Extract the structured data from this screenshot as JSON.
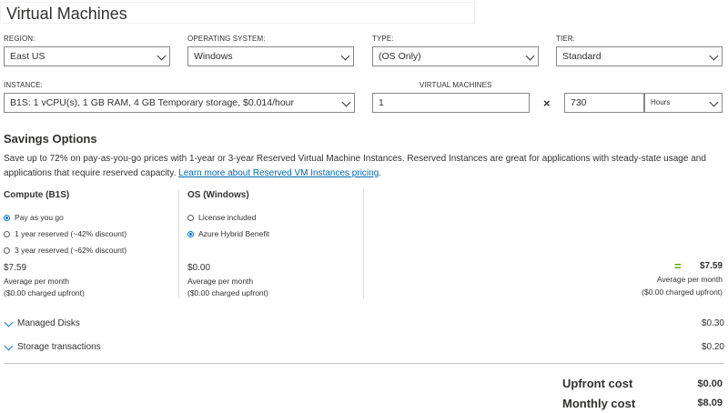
{
  "header": {
    "title": "Virtual Machines"
  },
  "fields": {
    "region": {
      "label": "REGION:",
      "value": "East US"
    },
    "os": {
      "label": "OPERATING SYSTEM:",
      "value": "Windows"
    },
    "type": {
      "label": "TYPE:",
      "value": "(OS Only)"
    },
    "tier": {
      "label": "TIER:",
      "value": "Standard"
    },
    "instance": {
      "label": "INSTANCE:",
      "value": "B1S: 1 vCPU(s), 1 GB RAM, 4 GB Temporary storage, $0.014/hour"
    },
    "vm_count": {
      "label": "VIRTUAL MACHINES",
      "value": "1"
    },
    "multiply": "×",
    "hours": {
      "value": "730",
      "unit": "Hours"
    }
  },
  "savings": {
    "title": "Savings Options",
    "description": "Save up to 72% on pay-as-you-go prices with 1-year or 3-year Reserved Virtual Machine Instances. Reserved Instances are great for applications with steady-state usage and applications that require reserved capacity.",
    "link": "Learn more about Reserved VM Instances pricing",
    "link_suffix": "."
  },
  "compute": {
    "title": "Compute (B1S)",
    "options": [
      {
        "label": "Pay as you go",
        "selected": true
      },
      {
        "label": "1 year reserved (~42% discount)",
        "selected": false
      },
      {
        "label": "3 year reserved (~62% discount)",
        "selected": false
      }
    ],
    "price": "$7.59",
    "per_month": "Average per month",
    "upfront": "($0.00 charged upfront)"
  },
  "os_license": {
    "title": "OS (Windows)",
    "options": [
      {
        "label": "License included",
        "selected": false
      },
      {
        "label": "Azure Hybrid Benefit",
        "selected": true
      }
    ],
    "price": "$0.00",
    "per_month": "Average per month",
    "upfront": "($0.00 charged upfront)"
  },
  "result": {
    "equals": "=",
    "price": "$7.59",
    "per_month": "Average per month",
    "upfront": "($0.00 charged upfront)"
  },
  "sections": [
    {
      "label": "Managed Disks",
      "value": "$0.30"
    },
    {
      "label": "Storage transactions",
      "value": "$0.20"
    }
  ],
  "totals": {
    "upfront_label": "Upfront cost",
    "upfront_value": "$0.00",
    "monthly_label": "Monthly cost",
    "monthly_value": "$8.09"
  },
  "colors": {
    "accent": "#0078d4",
    "link": "#0067b8",
    "equals": "#57a300"
  }
}
